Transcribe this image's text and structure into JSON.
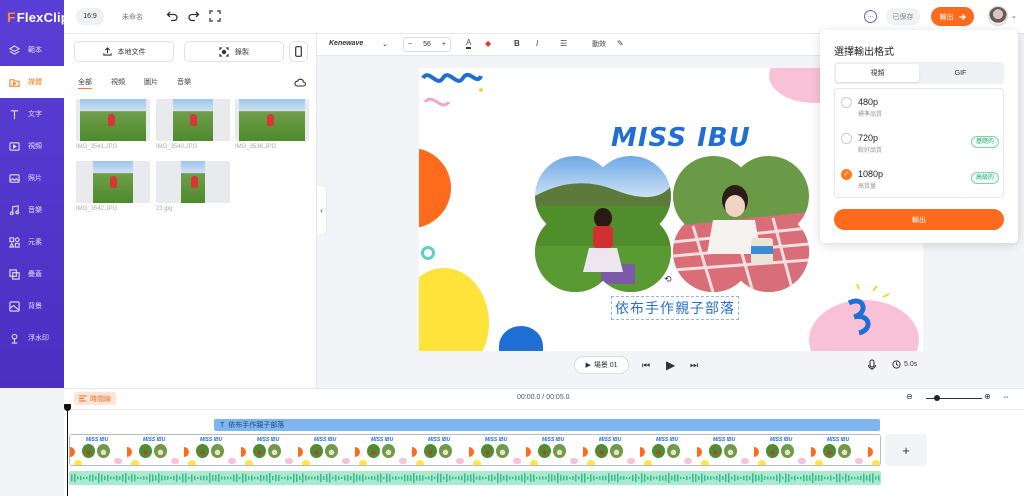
{
  "brand": {
    "name": "FlexClip"
  },
  "sidebar": {
    "items": [
      {
        "label": "範本",
        "icon": "layers-icon"
      },
      {
        "label": "媒體",
        "icon": "folder-icon",
        "active": true
      },
      {
        "label": "文字",
        "icon": "text-icon"
      },
      {
        "label": "視頻",
        "icon": "video-icon"
      },
      {
        "label": "照片",
        "icon": "photo-icon"
      },
      {
        "label": "音樂",
        "icon": "music-icon"
      },
      {
        "label": "元素",
        "icon": "elements-icon"
      },
      {
        "label": "疊蓋",
        "icon": "overlay-icon"
      },
      {
        "label": "背景",
        "icon": "background-icon"
      },
      {
        "label": "浮水印",
        "icon": "watermark-icon"
      }
    ]
  },
  "topbar": {
    "ratio": "16:9",
    "project_name": "未命名",
    "saved": "已保存",
    "export": "輸出"
  },
  "media": {
    "upload": "本地文件",
    "record": "錄製",
    "tabs": [
      "全部",
      "視頻",
      "圖片",
      "音樂"
    ],
    "active_tab": "全部",
    "files": [
      "IMG_3541.JPG",
      "IMG_3540.JPG",
      "IMG_3536.JPG",
      "IMG_3542.JPG",
      "23.jpg"
    ]
  },
  "format_bar": {
    "font": "Kenewave",
    "size": "56",
    "effects": "動效"
  },
  "canvas": {
    "title": "MISS IBU",
    "subtitle": "依布手作親子部落"
  },
  "playback": {
    "scene": "場景 01",
    "duration": "5.0s"
  },
  "export_popup": {
    "title": "選擇輸出格式",
    "tabs": [
      "視頻",
      "GIF"
    ],
    "active_tab": "視頻",
    "options": [
      {
        "name": "480p",
        "desc": "標準品質",
        "badge": "",
        "selected": false
      },
      {
        "name": "720p",
        "desc": "較好品質",
        "badge": "基礎的",
        "selected": false
      },
      {
        "name": "1080p",
        "desc": "高質量",
        "badge": "高級的",
        "selected": true
      }
    ],
    "button": "輸出"
  },
  "timeline": {
    "label": "時間線",
    "time": "00:00.0 / 00:05.0",
    "text_clip": "依布手作親子部落",
    "frame_title": "MISS IBU",
    "add": "+"
  },
  "colors": {
    "brand_purple": "#5a3fd6",
    "accent_orange": "#ff6a1c",
    "title_blue": "#1f6ed4"
  }
}
